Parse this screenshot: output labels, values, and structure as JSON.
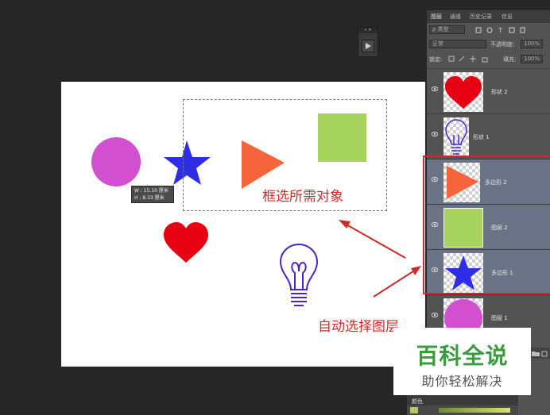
{
  "canvas": {
    "tooltip": {
      "w": "W : 15.10 厘米",
      "h": "H : 8.33 厘米"
    },
    "annotation_select": "框选所需对象",
    "annotation_auto": "自动选择图层"
  },
  "mini_toolbar": {
    "expand": "»",
    "close": "×"
  },
  "layers_panel": {
    "tabs": [
      "图层",
      "通道",
      "历史记录",
      "信息"
    ],
    "filter_label": "ρ 类型",
    "blend_mode": "正常",
    "opacity_label": "不透明度:",
    "opacity_value": "100%",
    "lock_label": "锁定:",
    "fill_label": "填充:",
    "fill_value": "100%",
    "layers": [
      {
        "name": "形状 2",
        "thumb": "heart-icon",
        "selected": false
      },
      {
        "name": "形状 1",
        "thumb": "lightbulb-icon",
        "selected": false
      },
      {
        "name": "多边形 2",
        "thumb": "triangle-icon",
        "selected": true
      },
      {
        "name": "图层 2",
        "thumb": "square-icon",
        "selected": true
      },
      {
        "name": "多边形 1",
        "thumb": "star-icon",
        "selected": true
      },
      {
        "name": "图层 1",
        "thumb": "circle-icon",
        "selected": false
      }
    ]
  },
  "color_panel": {
    "tab": "颜色"
  },
  "watermark": {
    "title": "百科全说",
    "subtitle": "助你轻松解决"
  },
  "colors": {
    "background": "#262626",
    "annotation_red": "#d22a2a",
    "circle": "#d24fd0",
    "star": "#2f2ee6",
    "triangle": "#f5643a",
    "square": "#a6d45c",
    "heart": "#e60012",
    "bulb": "#4a26c8",
    "watermark_green": "#3a9c3e"
  }
}
